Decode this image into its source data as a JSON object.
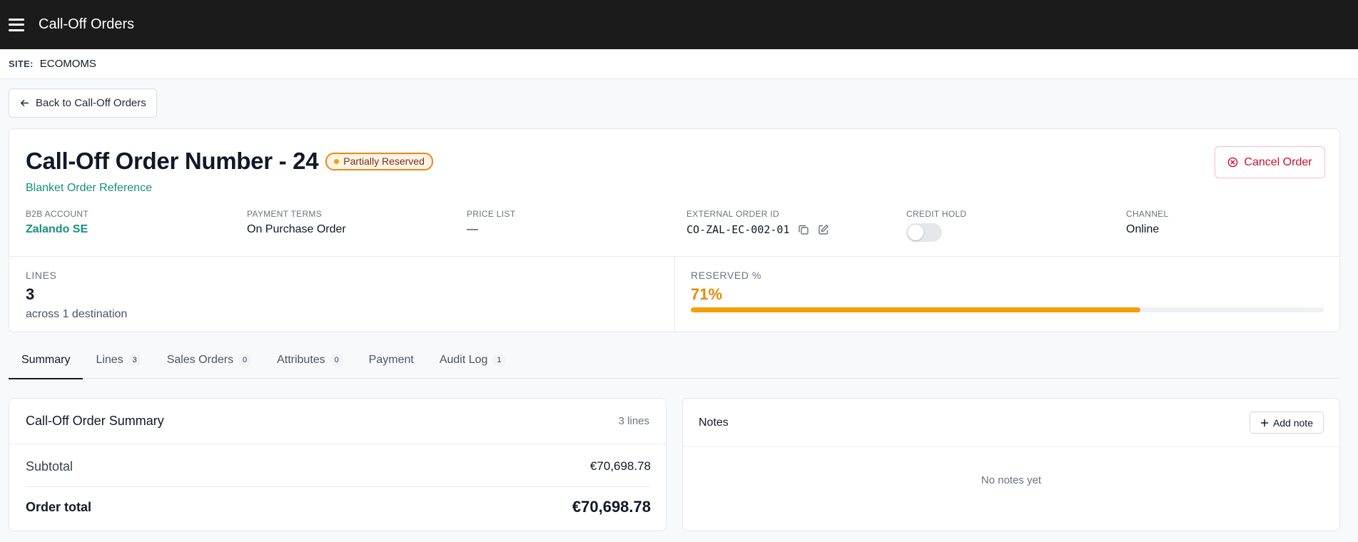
{
  "app": {
    "title": "Call-Off Orders"
  },
  "site": {
    "label": "SITE:",
    "value": "ECOMOMS"
  },
  "back_label": "Back to Call-Off Orders",
  "order": {
    "title": "Call-Off Order Number - 24",
    "status": "Partially Reserved",
    "blanket_link": "Blanket Order Reference",
    "cancel_label": "Cancel Order"
  },
  "meta": {
    "b2b_account": {
      "label": "B2B ACCOUNT",
      "value": "Zalando SE"
    },
    "payment_terms": {
      "label": "PAYMENT TERMS",
      "value": "On Purchase Order"
    },
    "price_list": {
      "label": "PRICE LIST",
      "value": "—"
    },
    "external_order_id": {
      "label": "EXTERNAL ORDER ID",
      "value": "CO-ZAL-EC-002-01"
    },
    "credit_hold": {
      "label": "CREDIT HOLD",
      "enabled": false
    },
    "channel": {
      "label": "CHANNEL",
      "value": "Online"
    }
  },
  "stats": {
    "lines": {
      "label": "LINES",
      "value": "3",
      "sub": "across 1 destination"
    },
    "reserved": {
      "label": "RESERVED %",
      "value": "71%",
      "fraction": 0.71
    }
  },
  "tabs": [
    {
      "label": "Summary",
      "count": null,
      "active": true
    },
    {
      "label": "Lines",
      "count": "3"
    },
    {
      "label": "Sales Orders",
      "count": "0"
    },
    {
      "label": "Attributes",
      "count": "0"
    },
    {
      "label": "Payment",
      "count": null
    },
    {
      "label": "Audit Log",
      "count": "1"
    }
  ],
  "summary": {
    "title": "Call-Off Order Summary",
    "count": "3 lines",
    "subtotal_label": "Subtotal",
    "subtotal_value": "€70,698.78",
    "total_label": "Order total",
    "total_value": "€70,698.78"
  },
  "notes": {
    "title": "Notes",
    "add_label": "Add note",
    "empty": "No notes yet"
  },
  "colors": {
    "accent": "#14917a",
    "danger": "#c8102e",
    "warning": "#f59e0b",
    "topbar": "#1b1b1b"
  },
  "icons": [
    "menu-icon",
    "arrow-left-icon",
    "x-circle-icon",
    "copy-icon",
    "edit-icon",
    "plus-icon"
  ]
}
